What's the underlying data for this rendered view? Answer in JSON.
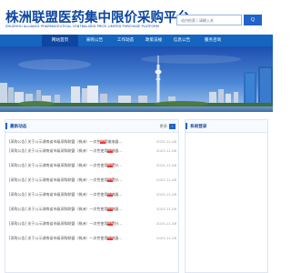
{
  "header": {
    "title": "株洲联盟医药集中限价采购平台",
    "subtitle": "ZHUZHOU ALLIANCE PHARMACEUTICAL CENTRALIZED PRICE LIMITED PURCHASE PLATFORM",
    "search_placeholder": "站内检索 | 请输入关",
    "search_button_label": "Q"
  },
  "nav": {
    "items": [
      {
        "label": "网站首页",
        "active": true
      },
      {
        "label": "采购公告",
        "active": false
      },
      {
        "label": "工作动态",
        "active": false
      },
      {
        "label": "政策法规",
        "active": false
      },
      {
        "label": "信息公告",
        "active": false
      },
      {
        "label": "服务咨询",
        "active": false
      }
    ]
  },
  "news": {
    "title": "最新动态",
    "more_label": "更多",
    "more_icon": "chevron-right-icon",
    "items": [
      {
        "text": "[采购公告] 关于公示湖南省市级采购联盟（株洲）一次性使用输液器...",
        "date": "2023-11-08",
        "new": true
      },
      {
        "text": "[采购公告] 关于公示湖南省市级采购联盟（株洲）一次性使用输液器...",
        "date": "2023-11-08",
        "new": true
      },
      {
        "text": "[采购公告] 关于公示湖南省市级采购联盟（株洲）一次性使用留置针...",
        "date": "2023-11-08",
        "new": true
      },
      {
        "text": "[采购公告] 关于公示湖南省市级采购联盟（株洲）一次性使用留置针...",
        "date": "2023-11-08",
        "new": true
      },
      {
        "text": "[采购公告] 关于公示湖南省市级采购联盟（株洲）一次性使用输液器...",
        "date": "2023-11-08",
        "new": true
      },
      {
        "text": "[采购公告] 关于公示湖南省市级采购联盟（株洲）一次性使用输液器...",
        "date": "2023-11-08",
        "new": true
      },
      {
        "text": "[采购公告] 关于公示湖南省市级采购联盟（株洲）一次性使用留置针...",
        "date": "2023-11-08",
        "new": true
      },
      {
        "text": "[采购公告] 关于公示湖南省市级采购联盟（株洲）一次性使用输液器...",
        "date": "2023-11-08",
        "new": true
      }
    ],
    "new_label": "NEW"
  },
  "system": {
    "title": "系统登录"
  },
  "colors": {
    "brand": "#0d47a1",
    "nav": "#1565c0",
    "accent": "#1e64c8",
    "new_badge": "#e53935"
  }
}
